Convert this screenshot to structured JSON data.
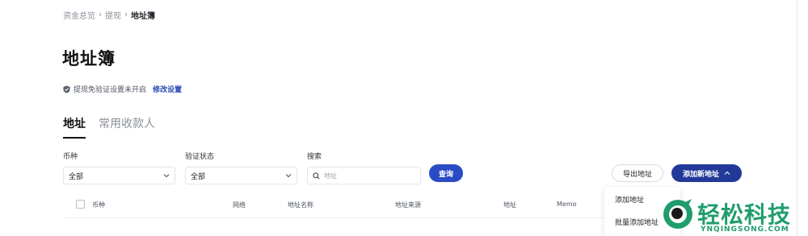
{
  "breadcrumb": {
    "items": [
      "资金总览",
      "提现"
    ],
    "current": "地址簿"
  },
  "page_title": "地址簿",
  "verify": {
    "text": "提现免验证设置未开启",
    "link": "修改设置"
  },
  "tabs": [
    {
      "label": "地址",
      "active": true
    },
    {
      "label": "常用收款人",
      "active": false
    }
  ],
  "filters": {
    "coin": {
      "label": "币种",
      "value": "全部"
    },
    "status": {
      "label": "验证状态",
      "value": "全部"
    },
    "search": {
      "label": "搜索",
      "placeholder": "地址"
    }
  },
  "buttons": {
    "query": "查询",
    "export": "导出地址",
    "add": "添加新地址"
  },
  "table": {
    "columns": [
      "币种",
      "网络",
      "地址名称",
      "地址来源",
      "地址",
      "Memo"
    ]
  },
  "dropdown": {
    "items": [
      "添加地址",
      "批量添加地址"
    ]
  },
  "watermark": {
    "title": "轻松科技",
    "subtitle": "YNQINGSONG.COM"
  },
  "colors": {
    "primary": "#2a4bc4",
    "primary_dark": "#23399a",
    "link": "#2c4ab5",
    "watermark": "#1f9d6c"
  },
  "icons": {
    "shield": "shield-icon",
    "search": "search-icon",
    "chevron_down": "chevron-down-icon",
    "chevron_up": "chevron-up-icon"
  }
}
